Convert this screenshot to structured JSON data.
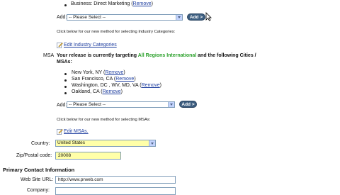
{
  "industries": {
    "items": [
      {
        "label": "Business: Direct Marketing",
        "remove": "Remove"
      }
    ],
    "add_label": "Add:",
    "select_value": "-- Please Select --",
    "add_button": "Add >",
    "note": "Click below for our new method for selecting Industry Categories:",
    "edit_link": "Edit Industry Categories"
  },
  "msa": {
    "label": "MSA",
    "intro_prefix": "Your release is currently targeting ",
    "intro_highlight": "All Regions International",
    "intro_suffix": " and the following Cities /",
    "intro_line2": "MSAs:",
    "items": [
      {
        "label": "New York, NY",
        "remove": "Remove"
      },
      {
        "label": "San Francisco, CA",
        "remove": "Remove"
      },
      {
        "label": "Washington, DC , WV, MD, VA",
        "remove": "Remove"
      },
      {
        "label": "Oakland, CA",
        "remove": "Remove"
      }
    ],
    "add_label": "Add:",
    "select_value": "-- Please Select --",
    "add_button": "Add >",
    "note": "Click below for our new method for selecting MSAs:",
    "edit_link": "Edit MSAs."
  },
  "country": {
    "label": "Country:",
    "value": "United States"
  },
  "zip": {
    "label": "Zip/Postal code:",
    "value": "20008"
  },
  "primary_contact": {
    "heading": "Primary Contact Information",
    "website_label": "Web Site URL:",
    "website_value": "http://www.prweb.com",
    "company_label": "Company:"
  },
  "colors": {
    "highlight_green": "#2aa02a",
    "link_blue": "#1f3fa0",
    "field_yellow": "#ffffa8",
    "button_blue": "#3d5e80"
  }
}
